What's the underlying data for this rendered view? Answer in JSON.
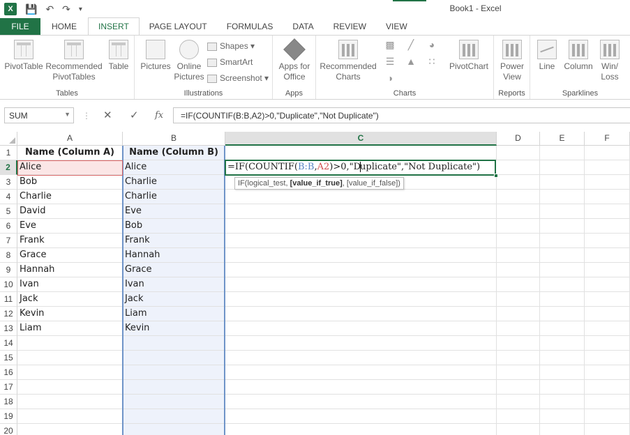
{
  "window": {
    "title": "Book1 - Excel",
    "logo": "X"
  },
  "qat": {
    "save_icon": "save-icon",
    "undo_icon": "undo-icon",
    "redo_icon": "redo-icon"
  },
  "tabs": [
    {
      "label": "FILE"
    },
    {
      "label": "HOME"
    },
    {
      "label": "INSERT"
    },
    {
      "label": "PAGE LAYOUT"
    },
    {
      "label": "FORMULAS"
    },
    {
      "label": "DATA"
    },
    {
      "label": "REVIEW"
    },
    {
      "label": "VIEW"
    }
  ],
  "ribbon": {
    "tables": {
      "label": "Tables",
      "pivottable": "PivotTable",
      "recommended": "Recommended",
      "recommended2": "PivotTables",
      "table": "Table"
    },
    "illustrations": {
      "label": "Illustrations",
      "pictures": "Pictures",
      "online": "Online",
      "online2": "Pictures",
      "shapes": "Shapes",
      "smartart": "SmartArt",
      "screenshot": "Screenshot"
    },
    "apps": {
      "label": "Apps",
      "apps_for": "Apps for",
      "office": "Office"
    },
    "charts": {
      "label": "Charts",
      "recommended": "Recommended",
      "recommended2": "Charts",
      "pivotchart": "PivotChart"
    },
    "reports": {
      "label": "Reports",
      "power": "Power",
      "view": "View"
    },
    "sparklines": {
      "label": "Sparklines",
      "line": "Line",
      "column": "Column",
      "winloss1": "Win/",
      "winloss2": "Loss"
    }
  },
  "formula_bar": {
    "name_box": "SUM",
    "cancel": "✕",
    "enter": "✓",
    "fx": "fx",
    "formula": "=IF(COUNTIF(B:B,A2)>0,\"Duplicate\",\"Not Duplicate\")"
  },
  "columns": [
    "A",
    "B",
    "C",
    "D",
    "E",
    "F"
  ],
  "rows": [
    "1",
    "2",
    "3",
    "4",
    "5",
    "6",
    "7",
    "8",
    "9",
    "10",
    "11",
    "12",
    "13",
    "14",
    "15",
    "16",
    "17",
    "18",
    "19",
    "20"
  ],
  "sheet": {
    "header_a": "Name (Column A)",
    "header_b": "Name (Column B)",
    "col_a": [
      "Alice",
      "Bob",
      "Charlie",
      "David",
      "Eve",
      "Frank",
      "Grace",
      "Hannah",
      "Ivan",
      "Jack",
      "Kevin",
      "Liam"
    ],
    "col_b": [
      "Alice",
      "Charlie",
      "Charlie",
      "Eve",
      "Bob",
      "Frank",
      "Hannah",
      "Grace",
      "Ivan",
      "Jack",
      "Liam",
      "Kevin"
    ]
  },
  "editing": {
    "part1": "=IF(COUNTIF(",
    "ref_b": "B:B",
    "comma": ",",
    "ref_a": "A2",
    "part2": ")>0,\"D",
    "part3": "uplicate\",\"Not Duplicate\")",
    "tooltip_start": "IF(logical_test, ",
    "tooltip_bold": "[value_if_true]",
    "tooltip_end": ", [value_if_false])"
  },
  "colors": {
    "accent": "#217346",
    "ref_b": "#5a86c6",
    "ref_a": "#d34f4f"
  }
}
